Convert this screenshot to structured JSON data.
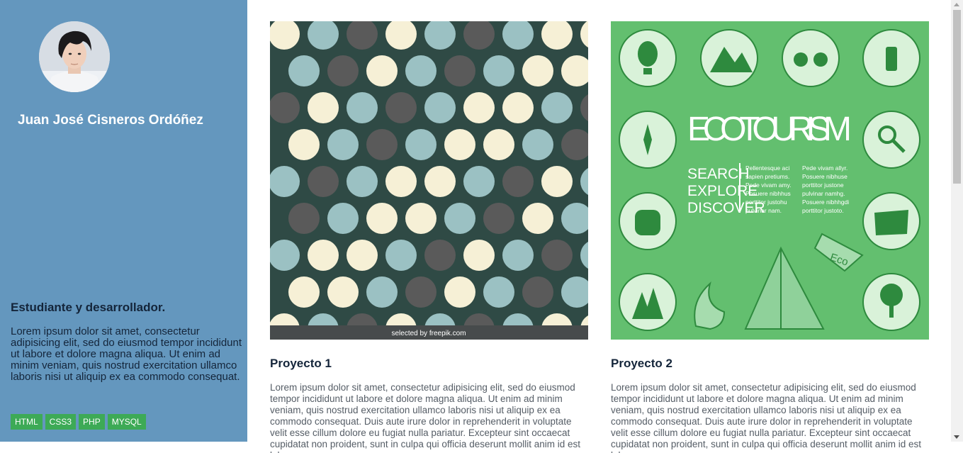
{
  "profile": {
    "name": "Juan José Cisneros Ordóñez",
    "role": "Estudiante y desarrollador.",
    "bio": "Lorem ipsum dolor sit amet, consectetur adipisicing elit, sed do eiusmod tempor incididunt ut labore et dolore magna aliqua. Ut enim ad minim veniam, quis nostrud exercitation ullamco laboris nisi ut aliquip ex ea commodo consequat.",
    "skills": [
      "HTML",
      "CSS3",
      "PHP",
      "MYSQL"
    ]
  },
  "projects": [
    {
      "title": "Proyecto 1",
      "image_credit": "selected by freepik.com",
      "description": "Lorem ipsum dolor sit amet, consectetur adipisicing elit, sed do eiusmod tempor incididunt ut labore et dolore magna aliqua. Ut enim ad minim veniam, quis nostrud exercitation ullamco laboris nisi ut aliquip ex ea commodo consequat. Duis aute irure dolor in reprehenderit in voluptate velit esse cillum dolore eu fugiat nulla pariatur. Excepteur sint occaecat cupidatat non proident, sunt in culpa qui officia deserunt mollit anim id est laborum."
    },
    {
      "title": "Proyecto 2",
      "image_heading": "ECOTOURISM",
      "image_words": [
        "SEARCH",
        "EXPLORE",
        "DISCOVER"
      ],
      "image_text_a": [
        "Pellentesque aci",
        "sapien pretiums.",
        "Pede vivam amy.",
        "Posuere nibhhus",
        "porttitor justohu",
        "pulvinar nam."
      ],
      "image_text_b": [
        "Pede vivam allyr.",
        "Posuere nibhuse",
        "porttitor justone",
        "pulvinar namhg.",
        "Posuere nibhhgdi",
        "porttitor justoto."
      ],
      "image_flag": "Eco",
      "description": "Lorem ipsum dolor sit amet, consectetur adipisicing elit, sed do eiusmod tempor incididunt ut labore et dolore magna aliqua. Ut enim ad minim veniam, quis nostrud exercitation ullamco laboris nisi ut aliquip ex ea commodo consequat. Duis aute irure dolor in reprehenderit in voluptate velit esse cillum dolore eu fugiat nulla pariatur. Excepteur sint occaecat cupidatat non proident, sunt in culpa qui officia deserunt mollit anim id est laborum."
    }
  ],
  "colors": {
    "sidebar": "#6497be",
    "tag": "#3daa56",
    "pattern_bg": "#2f4a45",
    "eco_green": "#63bf6f"
  }
}
